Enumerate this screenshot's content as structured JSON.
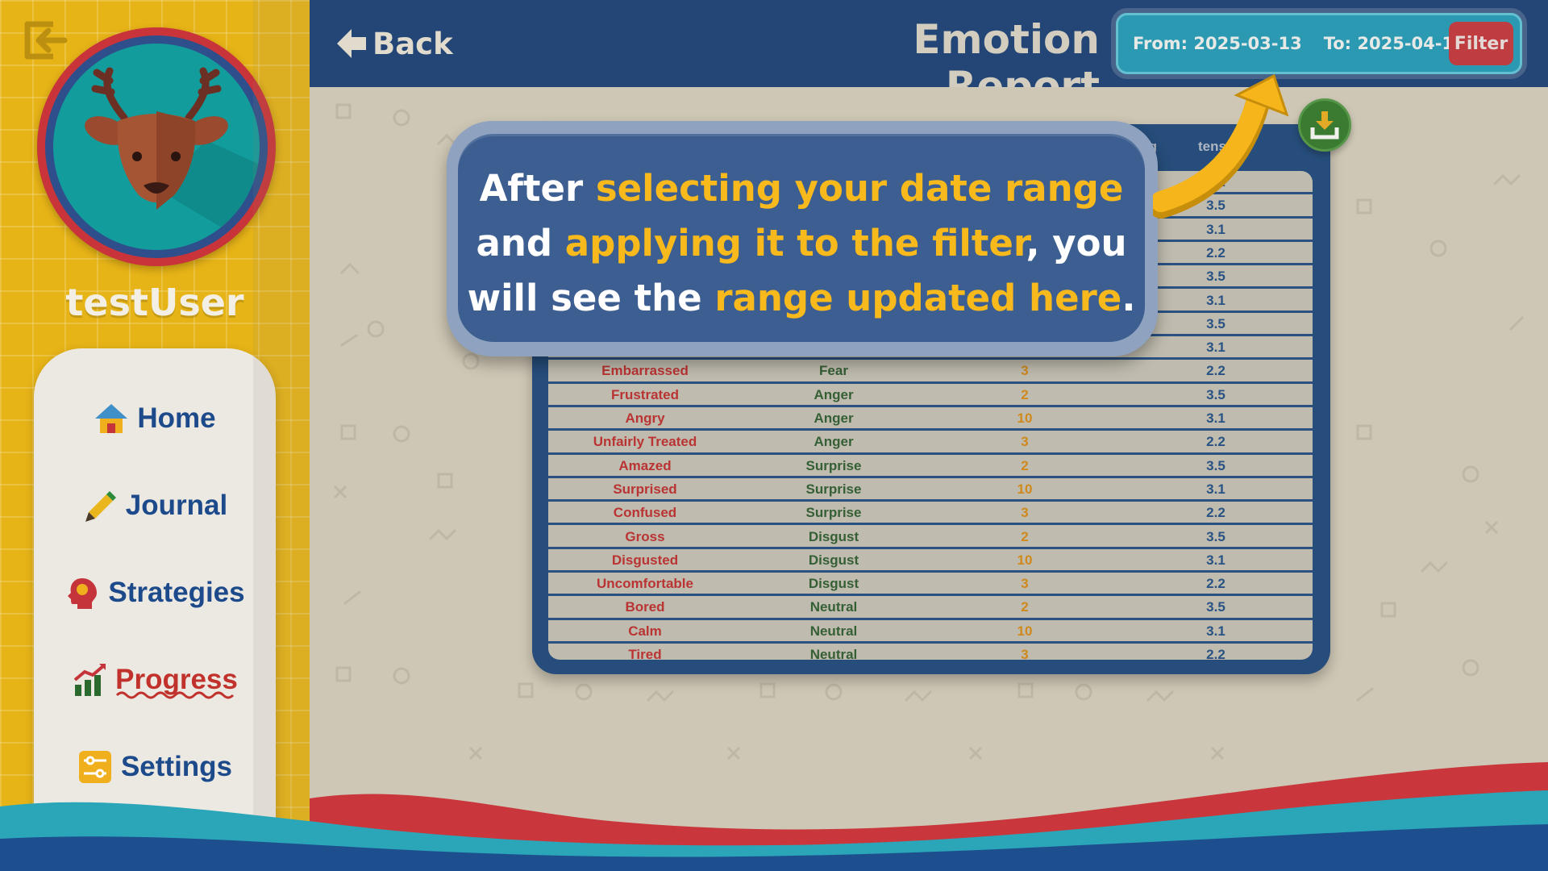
{
  "user": {
    "name": "testUser"
  },
  "nav": {
    "items": [
      {
        "id": "home",
        "label": "Home"
      },
      {
        "id": "journal",
        "label": "Journal"
      },
      {
        "id": "strategies",
        "label": "Strategies"
      },
      {
        "id": "progress",
        "label": "Progress"
      },
      {
        "id": "settings",
        "label": "Settings"
      }
    ]
  },
  "topbar": {
    "back_label": "Back",
    "title": "Emotion Report",
    "from_label": "From: 2025-03-13",
    "to_label": "To: 2025-04-13",
    "filter_label": "Filter"
  },
  "table": {
    "header_avg": "Averag",
    "header_intensity": "tens",
    "rows": [
      {
        "emotion": "Embarrassed",
        "category": "Fear",
        "count": "3",
        "avg": "2.2"
      },
      {
        "emotion": "Frustrated",
        "category": "Anger",
        "count": "2",
        "avg": "3.5"
      },
      {
        "emotion": "Angry",
        "category": "Anger",
        "count": "10",
        "avg": "3.1"
      },
      {
        "emotion": "Unfairly Treated",
        "category": "Anger",
        "count": "3",
        "avg": "2.2"
      },
      {
        "emotion": "Amazed",
        "category": "Surprise",
        "count": "2",
        "avg": "3.5"
      },
      {
        "emotion": "Surprised",
        "category": "Surprise",
        "count": "10",
        "avg": "3.1"
      },
      {
        "emotion": "Confused",
        "category": "Surprise",
        "count": "3",
        "avg": "2.2"
      },
      {
        "emotion": "Gross",
        "category": "Disgust",
        "count": "2",
        "avg": "3.5"
      },
      {
        "emotion": "Disgusted",
        "category": "Disgust",
        "count": "10",
        "avg": "3.1"
      },
      {
        "emotion": "Uncomfortable",
        "category": "Disgust",
        "count": "3",
        "avg": "2.2"
      },
      {
        "emotion": "Bored",
        "category": "Neutral",
        "count": "2",
        "avg": "3.5"
      },
      {
        "emotion": "Calm",
        "category": "Neutral",
        "count": "10",
        "avg": "3.1"
      },
      {
        "emotion": "Tired",
        "category": "Neutral",
        "count": "3",
        "avg": "2.2"
      }
    ],
    "hidden_avgs": [
      "2.2",
      "3.5",
      "3.1",
      "2.2",
      "3.5",
      "3.1",
      "3.5",
      "3.1"
    ]
  },
  "tooltip": {
    "line1_a": "After ",
    "line1_b": "selecting your date range",
    "line2_a": "and ",
    "line2_b": "applying it to the filter",
    "line2_c": ", you",
    "line3_a": "will see the ",
    "line3_b": "range updated here",
    "line3_c": "."
  },
  "icons": {
    "logout": "logout-icon",
    "back": "arrow-left-icon",
    "download": "download-icon",
    "home": "house-icon",
    "journal": "pencil-icon",
    "strategies": "head-icon",
    "progress": "chart-icon",
    "settings": "sliders-icon"
  },
  "colors": {
    "sidebar": "#e7b417",
    "topbar": "#163e78",
    "accent_red": "#c6343b",
    "filter_bg": "#1f9dbd",
    "highlight": "#f8b91c"
  }
}
